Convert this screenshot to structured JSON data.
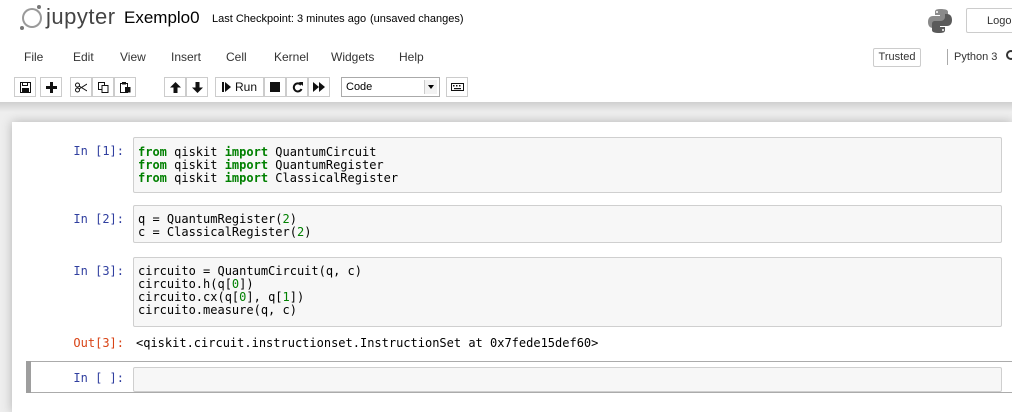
{
  "header": {
    "logo_text": "jupyter",
    "notebook_name": "Exemplo0",
    "checkpoint": "Last Checkpoint: 3 minutes ago",
    "unsaved": "(unsaved changes)",
    "logout_label": "Logout"
  },
  "menubar": {
    "items": [
      "File",
      "Edit",
      "View",
      "Insert",
      "Cell",
      "Kernel",
      "Widgets",
      "Help"
    ],
    "trusted_label": "Trusted",
    "kernel_name": "Python 3"
  },
  "toolbar": {
    "run_label": "Run",
    "cell_type": "Code",
    "icons": [
      "save-icon",
      "plus-icon",
      "cut-icon",
      "copy-icon",
      "paste-icon",
      "arrow-up-icon",
      "arrow-down-icon",
      "run-icon",
      "stop-icon",
      "restart-icon",
      "fast-forward-icon",
      "keyboard-icon"
    ]
  },
  "cells": [
    {
      "prompt": "In [1]:",
      "lines": [
        [
          [
            "kw",
            "from"
          ],
          [
            "",
            " qiskit "
          ],
          [
            "kw",
            "import"
          ],
          [
            "",
            " QuantumCircuit"
          ]
        ],
        [
          [
            "kw",
            "from"
          ],
          [
            "",
            " qiskit "
          ],
          [
            "kw",
            "import"
          ],
          [
            "",
            " QuantumRegister"
          ]
        ],
        [
          [
            "kw",
            "from"
          ],
          [
            "",
            " qiskit "
          ],
          [
            "kw",
            "import"
          ],
          [
            "",
            " ClassicalRegister"
          ]
        ]
      ]
    },
    {
      "prompt": "In [2]:",
      "lines": [
        [
          [
            "",
            "q = QuantumRegister("
          ],
          [
            "num",
            "2"
          ],
          [
            "",
            ")"
          ]
        ],
        [
          [
            "",
            "c = ClassicalRegister("
          ],
          [
            "num",
            "2"
          ],
          [
            "",
            ")"
          ]
        ]
      ]
    },
    {
      "prompt": "In [3]:",
      "lines": [
        [
          [
            "",
            "circuito = QuantumCircuit(q, c)"
          ]
        ],
        [
          [
            "",
            "circuito.h(q["
          ],
          [
            "num",
            "0"
          ],
          [
            "",
            "])"
          ]
        ],
        [
          [
            "",
            "circuito.cx(q["
          ],
          [
            "num",
            "0"
          ],
          [
            "",
            "], q["
          ],
          [
            "num",
            "1"
          ],
          [
            "",
            "])"
          ]
        ],
        [
          [
            "",
            "circuito.measure(q, c)"
          ]
        ]
      ]
    }
  ],
  "output": {
    "prompt": "Out[3]:",
    "text": "<qiskit.circuit.instructionset.InstructionSet at 0x7fede15def60>"
  },
  "empty_cell": {
    "prompt": "In [ ]:"
  }
}
